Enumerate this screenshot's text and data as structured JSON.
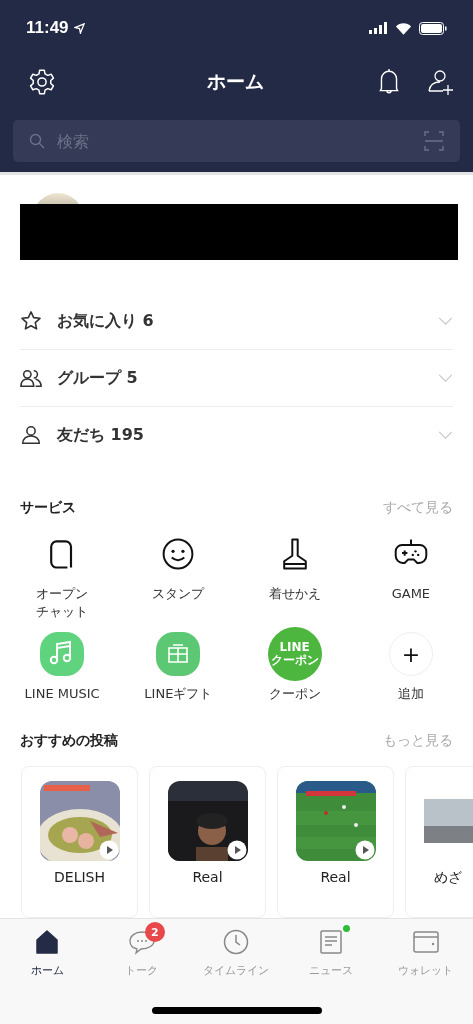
{
  "status_bar": {
    "time": "11:49"
  },
  "header": {
    "title": "ホーム"
  },
  "search": {
    "placeholder": "検索"
  },
  "profile": {
    "redacted": true
  },
  "lists": [
    {
      "kind": "star",
      "label": "お気に入り 6",
      "expanded": false
    },
    {
      "kind": "group",
      "label": "グループ 5",
      "expanded": false
    },
    {
      "kind": "person",
      "label": "友だち 195",
      "expanded": false
    }
  ],
  "services": {
    "title": "サービス",
    "more": "すべて見る",
    "items": [
      {
        "kind": "openchat",
        "label": "オープンチャット"
      },
      {
        "kind": "sticker",
        "label": "スタンプ"
      },
      {
        "kind": "theme",
        "label": "着せかえ"
      },
      {
        "kind": "game",
        "label": "GAME"
      },
      {
        "kind": "music",
        "label": "LINE MUSIC"
      },
      {
        "kind": "gift",
        "label": "LINEギフト"
      },
      {
        "kind": "coupon",
        "label": "クーポン",
        "icon_text": [
          "LINE",
          "クーポン"
        ]
      },
      {
        "kind": "add",
        "label": "追加",
        "icon_text": [
          "+"
        ]
      }
    ]
  },
  "posts": {
    "title": "おすすめの投稿",
    "more": "もっと見る",
    "items": [
      {
        "title": "DELISH",
        "video": true,
        "kind": "food"
      },
      {
        "title": "Real",
        "video": true,
        "kind": "portrait"
      },
      {
        "title": "Real",
        "video": true,
        "kind": "pitch"
      },
      {
        "title": "めざ",
        "video": false,
        "kind": "portrait"
      }
    ]
  },
  "tabs": [
    {
      "label": "ホーム",
      "kind": "home",
      "selected": true
    },
    {
      "label": "トーク",
      "kind": "chat",
      "selected": false,
      "badge": "2"
    },
    {
      "label": "タイムライン",
      "kind": "clock",
      "selected": false
    },
    {
      "label": "ニュース",
      "kind": "news",
      "selected": false,
      "dot": true
    },
    {
      "label": "ウォレット",
      "kind": "wallet",
      "selected": false
    }
  ]
}
